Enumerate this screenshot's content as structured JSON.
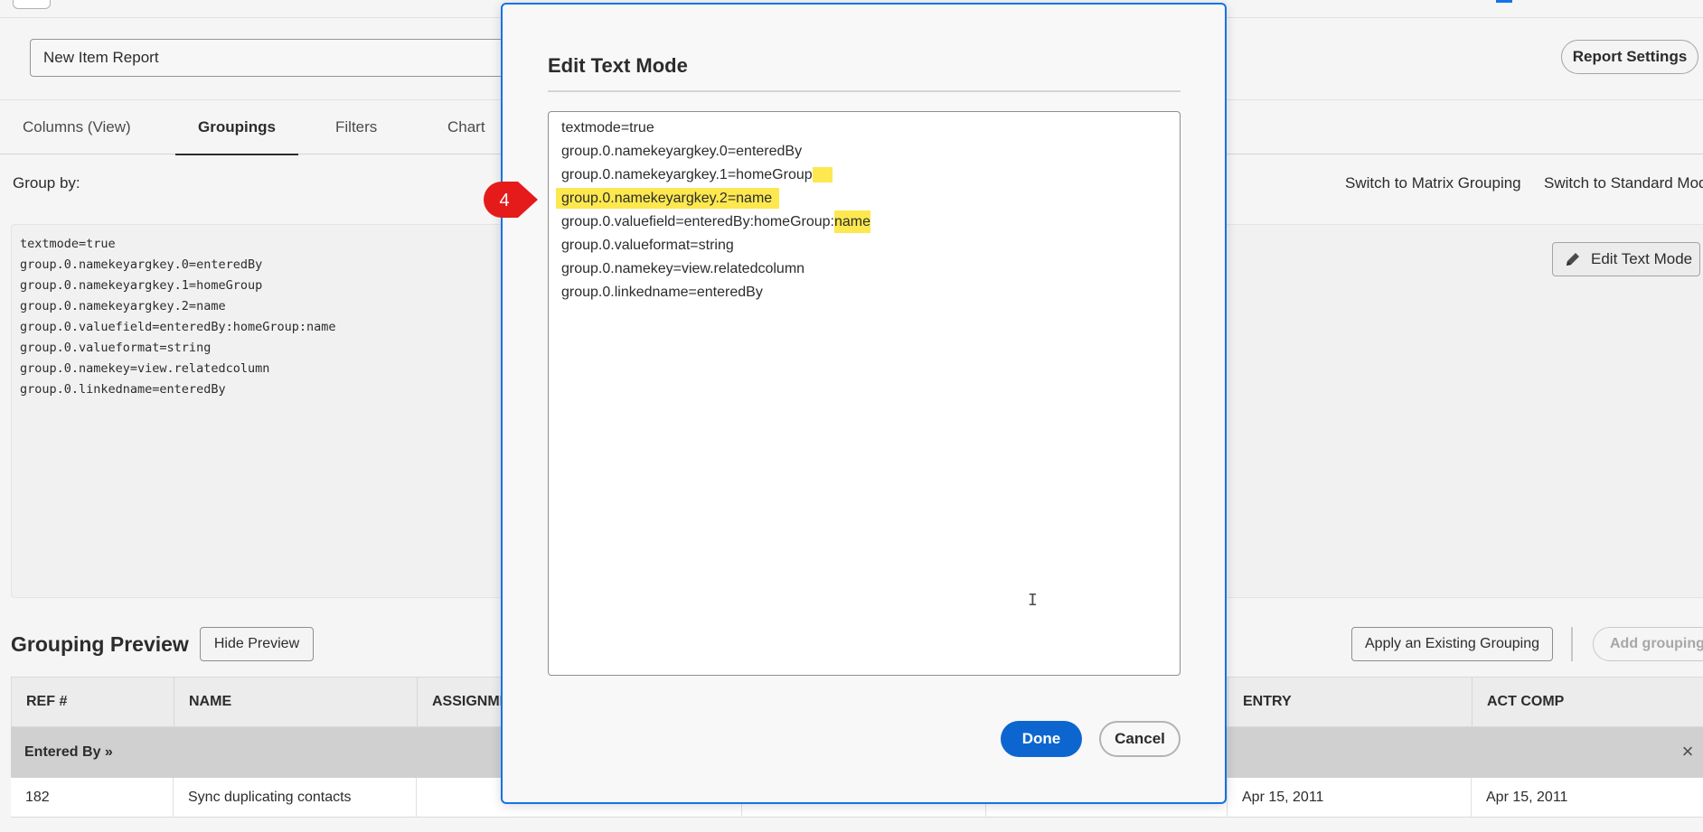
{
  "page": {
    "report_name": "New Item Report",
    "report_settings_label": "Report Settings",
    "tabs": [
      {
        "label": "Columns (View)"
      },
      {
        "label": "Groupings"
      },
      {
        "label": "Filters"
      },
      {
        "label": "Chart"
      }
    ],
    "group_by_label": "Group by:",
    "switch_matrix_label": "Switch to Matrix Grouping",
    "switch_standard_label": "Switch to Standard Mode",
    "edit_text_mode_label": "Edit Text Mode",
    "code_lines": [
      "textmode=true",
      "group.0.namekeyargkey.0=enteredBy",
      "group.0.namekeyargkey.1=homeGroup",
      "group.0.namekeyargkey.2=name",
      "group.0.valuefield=enteredBy:homeGroup:name",
      "group.0.valueformat=string",
      "group.0.namekey=view.relatedcolumn",
      "group.0.linkedname=enteredBy"
    ],
    "preview": {
      "title": "Grouping Preview",
      "hide_preview_label": "Hide Preview",
      "apply_existing_label": "Apply an Existing Grouping",
      "add_grouping_label": "Add grouping",
      "columns": [
        "REF #",
        "NAME",
        "ASSIGNME",
        "ENTRY",
        "ACT COMP"
      ],
      "group_row_label": "Entered By »",
      "rows": [
        {
          "ref": "182",
          "name": "Sync duplicating contacts",
          "entry": "Apr 15, 2011",
          "act_comp": "Apr 15, 2011"
        }
      ]
    }
  },
  "modal": {
    "title": "Edit Text Mode",
    "lines": [
      "textmode=true",
      "group.0.namekeyargkey.0=enteredBy",
      "group.0.namekeyargkey.1=homeGroup",
      "group.0.namekeyargkey.2=name",
      "group.0.valuefield=enteredBy:homeGroup:",
      "name",
      "group.0.valueformat=string",
      "group.0.namekey=view.relatedcolumn",
      "group.0.linkedname=enteredBy"
    ],
    "done_label": "Done",
    "cancel_label": "Cancel",
    "highlight_color": "#fde84f",
    "step_number": "4",
    "step_color": "#e51b1b"
  }
}
